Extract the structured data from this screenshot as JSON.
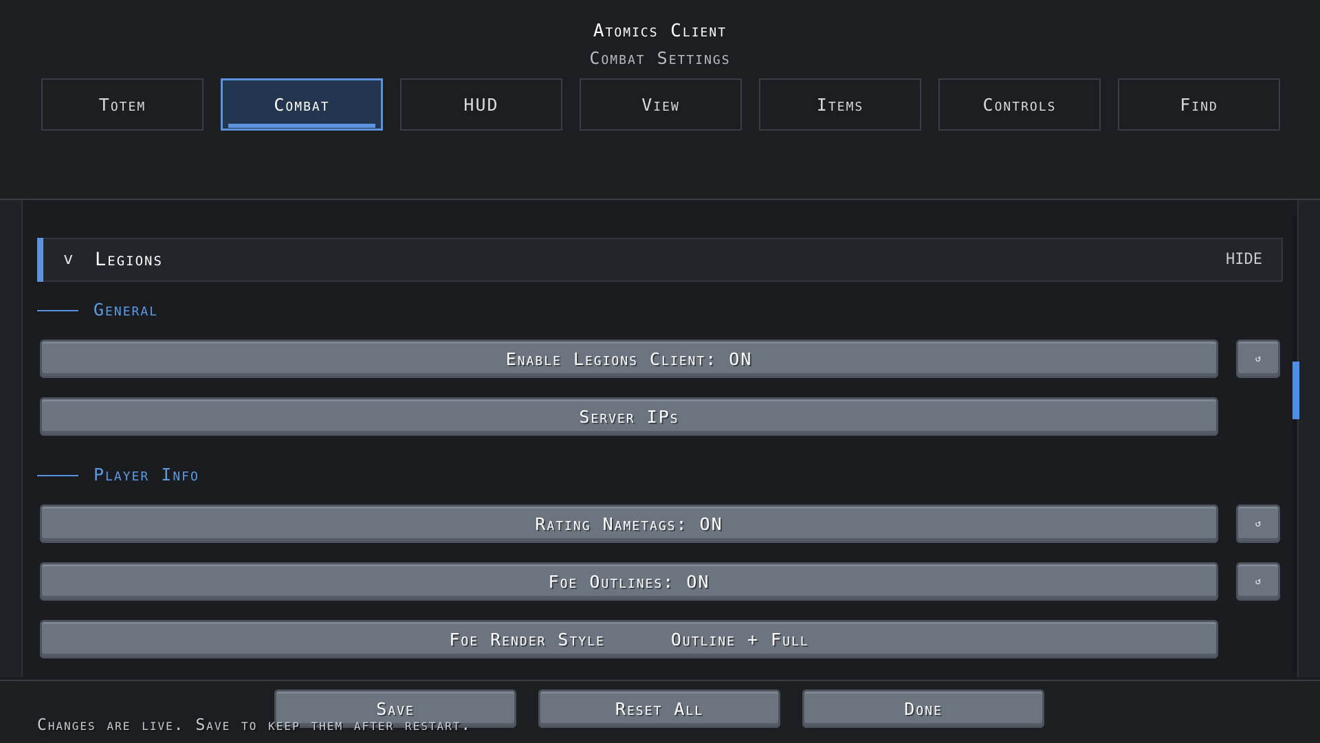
{
  "header": {
    "app_title": "Atomics Client",
    "page_subtitle": "Combat Settings"
  },
  "tabs": [
    {
      "label": "Totem",
      "active": false
    },
    {
      "label": "Combat",
      "active": true
    },
    {
      "label": "HUD",
      "active": false
    },
    {
      "label": "View",
      "active": false
    },
    {
      "label": "Items",
      "active": false
    },
    {
      "label": "Controls",
      "active": false
    },
    {
      "label": "Find",
      "active": false
    }
  ],
  "section": {
    "chevron": "v",
    "title": "Legions",
    "toggle_label": "HIDE"
  },
  "groups": [
    {
      "label": "General",
      "settings": [
        {
          "label": "Enable Legions Client: ON",
          "has_reset": true
        },
        {
          "label": "Server IPs",
          "has_reset": false
        }
      ]
    },
    {
      "label": "Player Info",
      "settings": [
        {
          "label": "Rating Nametags: ON",
          "has_reset": true
        },
        {
          "label": "Foe Outlines: ON",
          "has_reset": true
        },
        {
          "label": "Foe Render Style",
          "value": "Outline + Full",
          "has_reset": false
        }
      ]
    }
  ],
  "reset_icon": "↺",
  "footer": {
    "save_label": "Save",
    "reset_all_label": "Reset All",
    "done_label": "Done",
    "hint": "Changes are live. Save to keep them after restart."
  },
  "colors": {
    "accent": "#5d92de",
    "background": "#1c1e22",
    "button": "#6b747f"
  }
}
